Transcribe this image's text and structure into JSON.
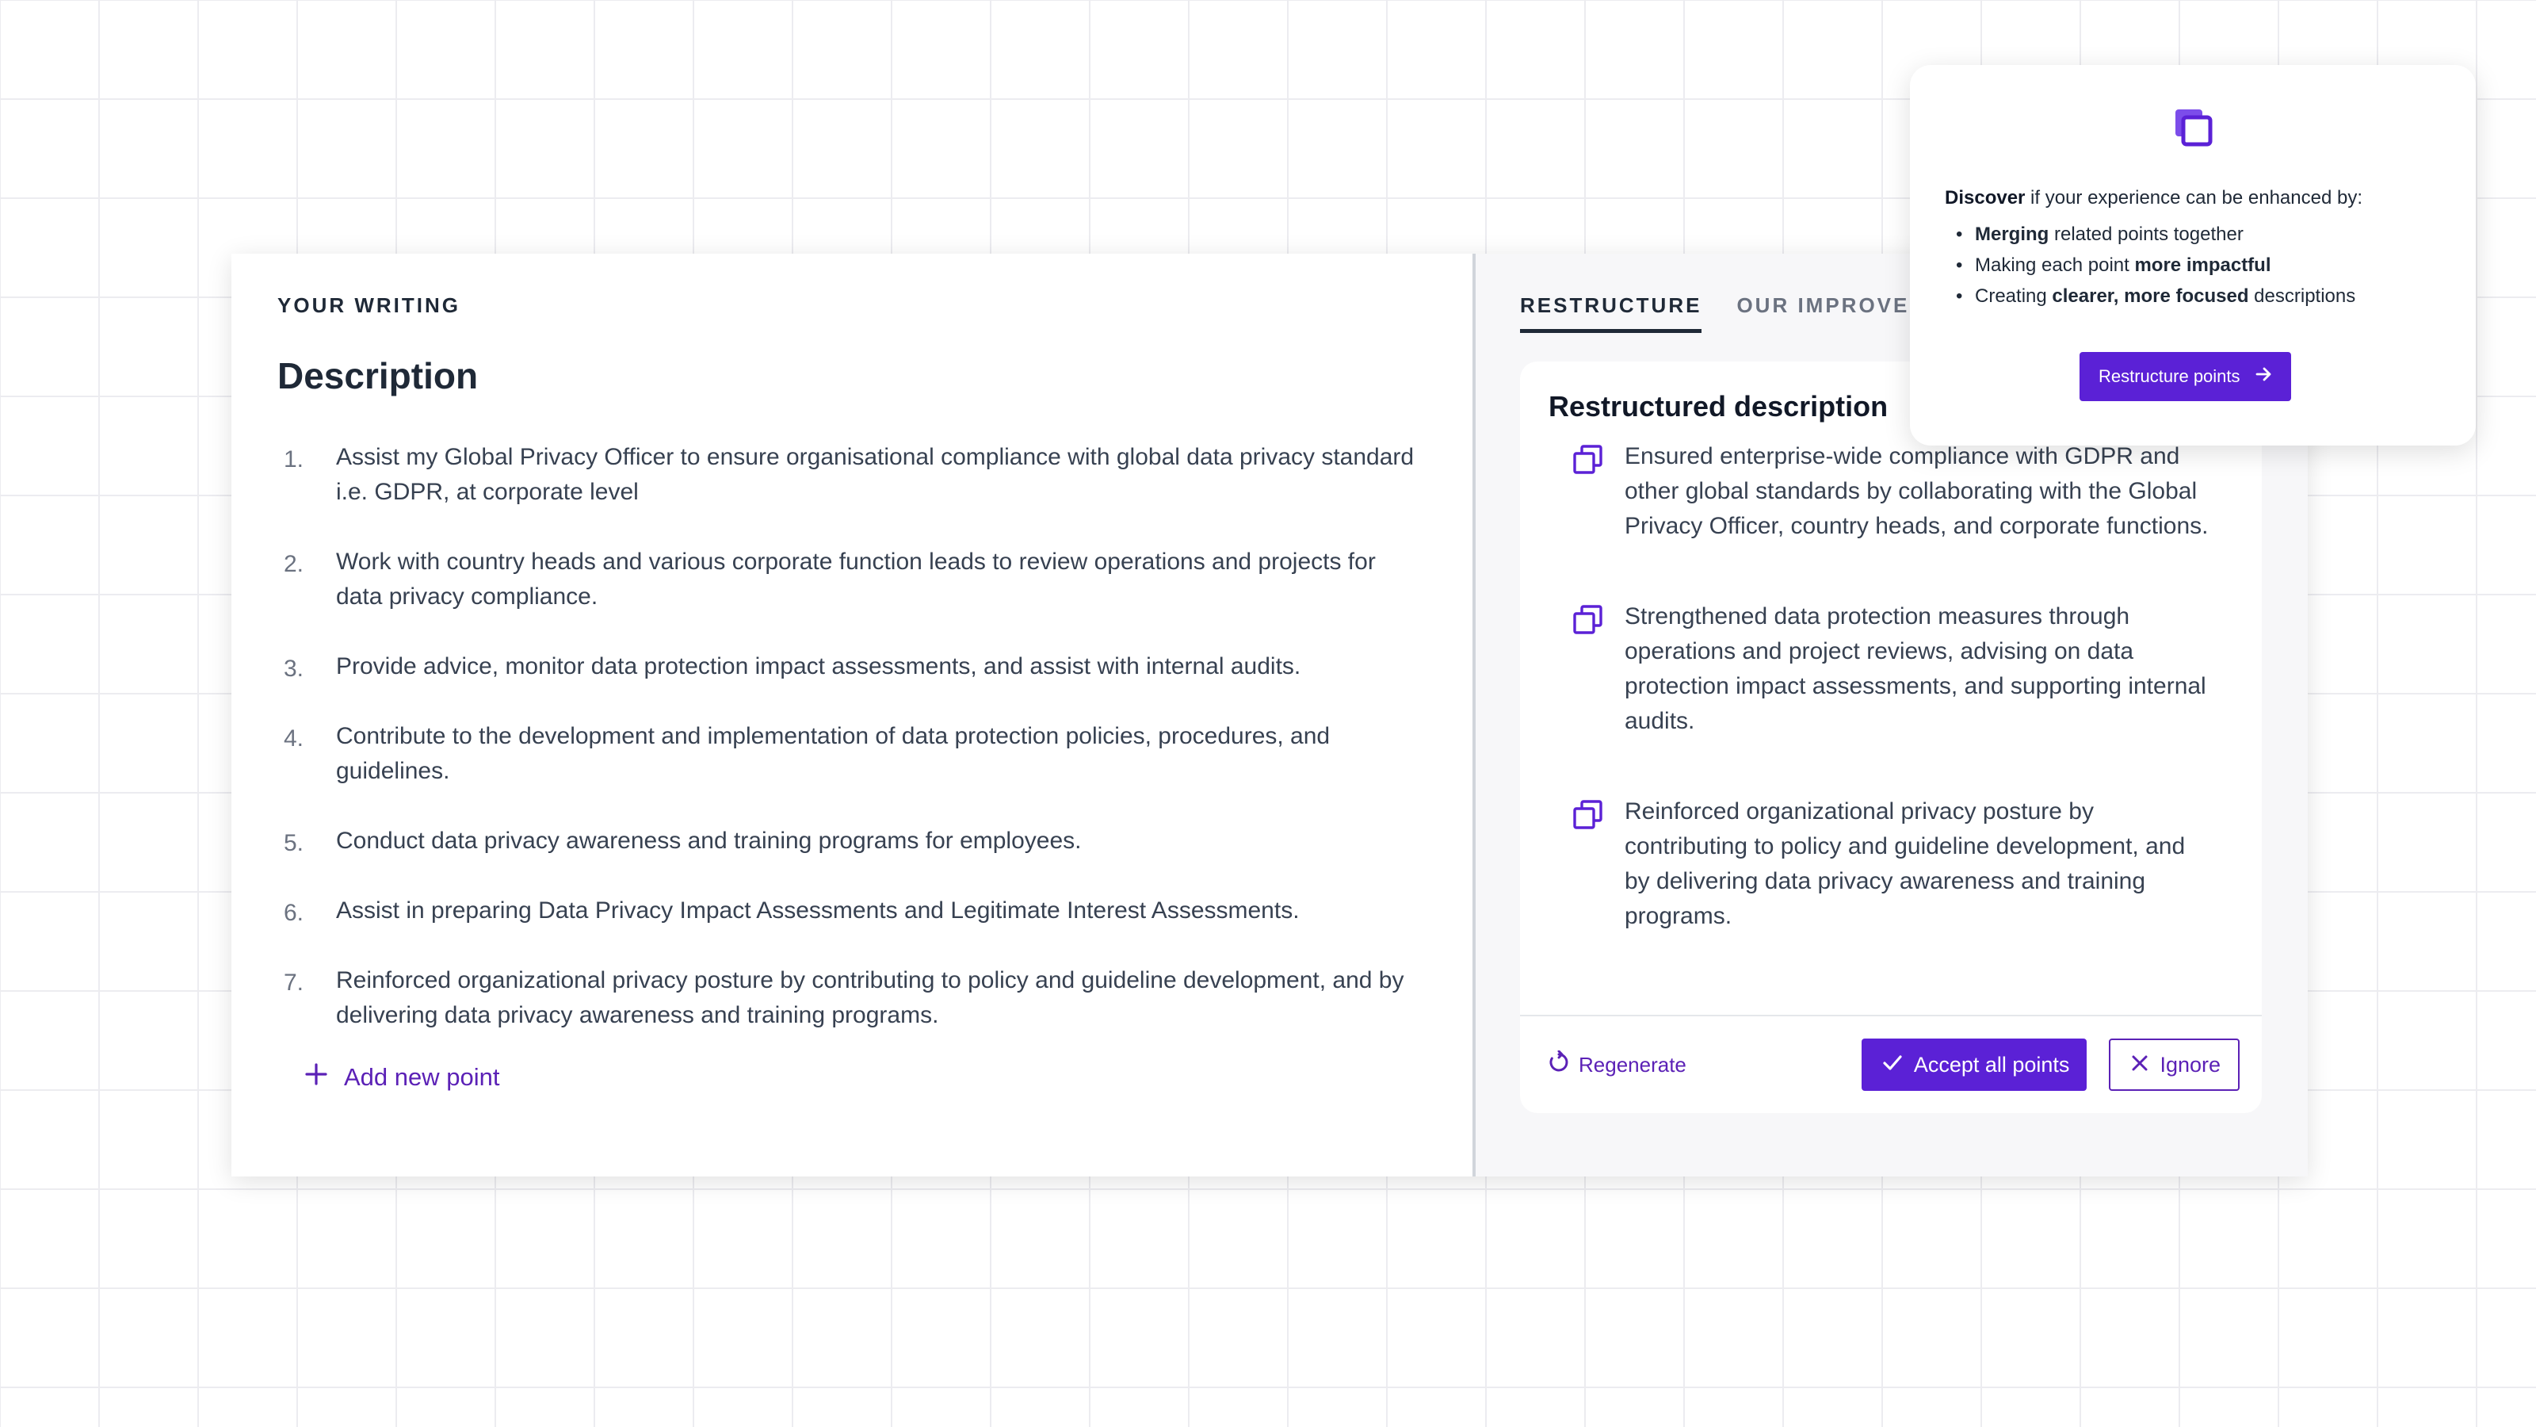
{
  "left": {
    "eyebrow": "YOUR WRITING",
    "title": "Description",
    "items": [
      {
        "num": "1.",
        "text": "Assist my Global Privacy Officer to ensure organisational compliance with global data privacy standard i.e. GDPR, at corporate level"
      },
      {
        "num": "2.",
        "text": "Work with country heads and various corporate function leads to review operations and projects for data privacy compliance."
      },
      {
        "num": "3.",
        "text": "Provide advice, monitor data protection impact assessments, and assist with internal audits."
      },
      {
        "num": "4.",
        "text": "Contribute to the development and implementation of data protection policies, procedures, and guidelines."
      },
      {
        "num": "5.",
        "text": "Conduct data privacy awareness and training programs for employees."
      },
      {
        "num": "6.",
        "text": "Assist in preparing Data Privacy Impact Assessments and Legitimate Interest Assessments."
      },
      {
        "num": "7.",
        "text": "Reinforced organizational privacy posture by contributing to policy and guideline development, and by delivering data privacy awareness and training programs."
      }
    ],
    "add_label": "Add new point"
  },
  "right": {
    "tabs": [
      "RESTRUCTURE",
      "OUR IMPROVEME"
    ],
    "panel_title": "Restructured description",
    "points": [
      "Ensured enterprise-wide compliance with GDPR and other global standards by collaborating with the Global Privacy Officer, country heads, and corporate functions.",
      "Strengthened data protection measures through operations and project reviews, advising on data protection impact assessments, and supporting internal audits.",
      "Reinforced organizational privacy posture by contributing to policy and guideline development, and by delivering data privacy awareness and training programs."
    ],
    "regenerate_label": "Regenerate",
    "accept_label": "Accept all points",
    "ignore_label": "Ignore"
  },
  "popup": {
    "intro_bold": "Discover",
    "intro_rest": " if your experience can be enhanced by:",
    "bullets": [
      {
        "a": "",
        "b": "Merging",
        "c": " related points together"
      },
      {
        "a": "Making each point ",
        "b": "more impactful",
        "c": ""
      },
      {
        "a": "Creating ",
        "b": "clearer, more focused",
        "c": " descriptions"
      }
    ],
    "button_label": "Restructure points"
  },
  "colors": {
    "accent": "#5b21d6",
    "accent_text": "#5b21b6",
    "panel_bg": "#f7f7f9",
    "grid": "#ececf0"
  },
  "icons": {
    "restructure": "copy-icon",
    "add": "plus-icon",
    "regenerate": "refresh-icon",
    "accept": "check-icon",
    "ignore": "close-icon",
    "arrow": "arrow-right-icon"
  }
}
